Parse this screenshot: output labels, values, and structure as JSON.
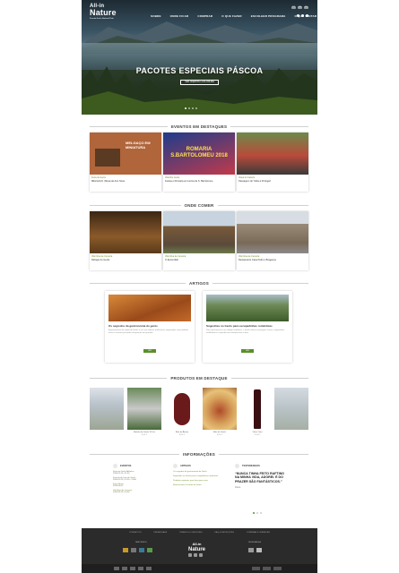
{
  "header": {
    "logo_line1": "All-in",
    "logo_line2": "Nature",
    "logo_line3": "Peneda-Gerês National Park",
    "menu": [
      "SOBRE",
      "ONDE FICAR",
      "COMPRAR",
      "O QUE FAZER",
      "ESCOLHER PROGRAMA",
      "O QUE VISITAR"
    ],
    "lang": [
      "PT",
      "EN",
      "ES"
    ]
  },
  "hero": {
    "title": "PACOTES ESPECIAIS PÁSCOA",
    "button": "VER OFERTAS LOJA ONLINE"
  },
  "sections": {
    "events": "EVENTOS EM DESTAQUES",
    "eat": "ONDE COMER",
    "articles": "ARTIGOS",
    "products": "PRODUTOS EM DESTAQUE",
    "info": "INFORMAÇÕES"
  },
  "events": [
    {
      "tag": "Feira de Gerês",
      "title": "MELGAÇO | Mesa de Ano Nova",
      "overlay": "MELGAÇO EM MINIATURA"
    },
    {
      "tag": "Vilarinho Gerês",
      "title": "Festas e Romaria em Honra de S. Bartolomeu",
      "overlay": "ROMARIA S.BARTOLOMEU 2018"
    },
    {
      "tag": "Viana do Castelo",
      "title": "Passagem do 'Volta a Portugal'",
      "overlay": ""
    }
  ],
  "eat": [
    {
      "tag": "Vila Nova de Cerveira",
      "title": "Refúgio do Gerês"
    },
    {
      "tag": "Vila Nova de Cerveira",
      "title": "O Escondido"
    },
    {
      "tag": "Vila Nova de Cerveira",
      "title": "Restaurante Casa Pedro | Bragança"
    }
  ],
  "articles": [
    {
      "title": "Os segredos da gastronomia do gerês",
      "text": "A gastronomia da região do Gerês é rica em sabores tradicionais, preparados com produtos locais e receitas passadas de geração em geração.",
      "button": "VER"
    },
    {
      "title": "Sugestões no Gerês para escapadinhas românticas",
      "text": "Para quem procura um refúgio romântico, o Gerês oferece paisagens únicas, alojamentos acolhedores e experiências inesquecíveis a dois.",
      "button": "VER"
    }
  ],
  "products": [
    {
      "name": "",
      "price": ""
    },
    {
      "name": "Bolinho do Gerês 10 Uni",
      "price": "8,50 €"
    },
    {
      "name": "Bolo de Ânimo",
      "price": "8,00 €"
    },
    {
      "name": "Bolo de Gerês",
      "price": "4,00 €"
    },
    {
      "name": "Vinho Tinto",
      "price": "12,00 €"
    },
    {
      "name": "",
      "price": ""
    }
  ],
  "info": {
    "c1": {
      "heading": "EVENTOS",
      "rows": [
        {
          "a": "Feira do Gerês Atlântico",
          "b": "2018-02-15 | 11:00"
        },
        {
          "a": "Festival de Jazz de Gerês",
          "b": "2018-02-20 | 12:00 - 13:00"
        },
        {
          "a": "Festa Brava",
          "b": "2018-03-01"
        },
        {
          "a": "Vila Nova de Cerveira",
          "b": "2018-03-10 | 10:00"
        }
      ]
    },
    "c2": {
      "heading": "ARTIGOS",
      "rows": [
        {
          "a": "Os segredos da gastronomia do Gerês",
          "b": ""
        },
        {
          "a": "Sugestões no Gerês para escapadinhas românticas",
          "b": ""
        },
        {
          "a": "Produtos regionais para levar para casa",
          "b": ""
        },
        {
          "a": "Roteiro pelas cascatas do Gerês",
          "b": ""
        }
      ]
    },
    "c3": {
      "heading": "TESTEMUNHOS",
      "quote": "“NUNCA TINHA FEITO RAFTING NA MINHA VIDA, ADOREI. É DO PRAZER SÃO FANTÁSTICOS.”",
      "author": "Diana"
    }
  },
  "footer": {
    "links": [
      "CONTACTOS",
      "PRIVACIDADE",
      "TERMOS & CONDIÇÕES",
      "FAQ & INSTRUÇÕES",
      "COMPRAR & OFERECER"
    ],
    "left_label": "PARCEIROS",
    "right_label": "SEGURANÇA",
    "logo1": "All-in",
    "logo2": "Nature"
  }
}
